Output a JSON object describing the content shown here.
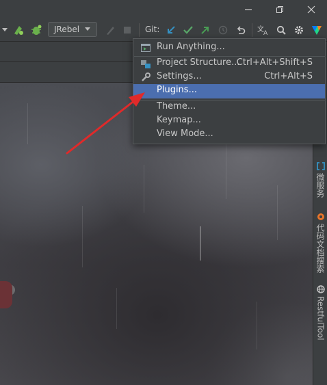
{
  "toolbar": {
    "jrebel_label": "JRebel",
    "git_label": "Git:"
  },
  "menu": {
    "items": [
      {
        "label": "Run Anything...",
        "shortcut": "",
        "icon": "run-anything-icon"
      },
      {
        "label": "Project Structure...",
        "shortcut": "Ctrl+Alt+Shift+S",
        "icon": "project-structure-icon"
      },
      {
        "label": "Settings...",
        "shortcut": "Ctrl+Alt+S",
        "icon": "wrench-icon"
      },
      {
        "label": "Plugins...",
        "shortcut": "",
        "icon": ""
      },
      {
        "label": "Theme...",
        "shortcut": "",
        "icon": ""
      },
      {
        "label": "Keymap...",
        "shortcut": "",
        "icon": ""
      },
      {
        "label": "View Mode...",
        "shortcut": "",
        "icon": ""
      }
    ],
    "selected": "Plugins..."
  },
  "right_sidebar": {
    "tools": [
      {
        "label": "微服务",
        "icon": "microservice-icon"
      },
      {
        "label": "代码文档搜索",
        "icon": "doc-search-icon"
      },
      {
        "label": "RestfulTool",
        "icon": "globe-icon"
      }
    ]
  },
  "colors": {
    "selection": "#4b6eaf",
    "annotation_arrow": "#e02a2a",
    "git_update": "#3592c4",
    "git_commit": "#59a869",
    "git_push": "#499c54"
  }
}
